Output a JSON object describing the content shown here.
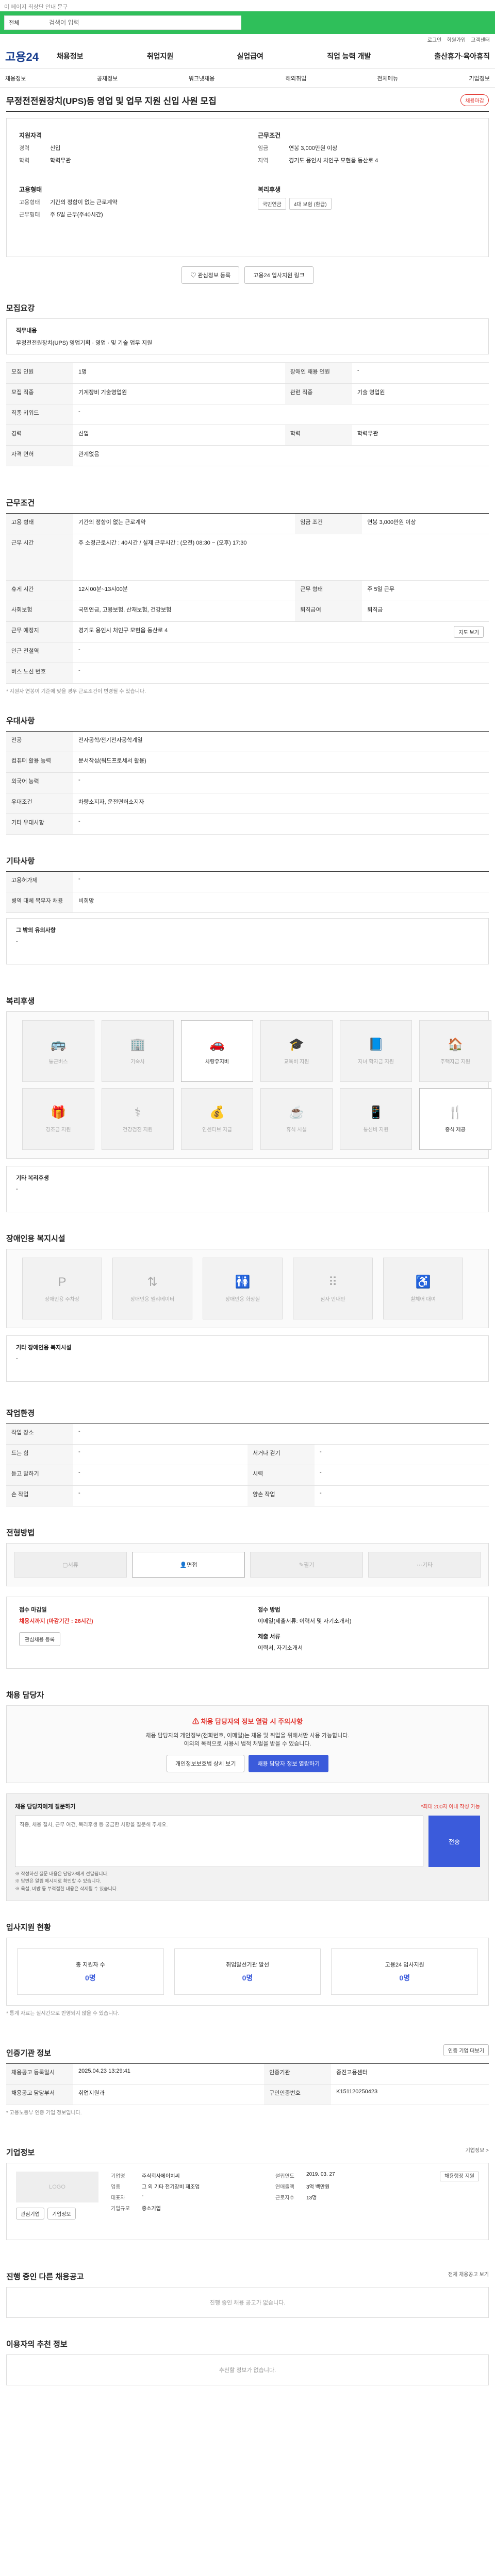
{
  "topnote": "이 페이지 최상단 안내 문구",
  "search": {
    "select": "전체",
    "placeholder": "검색어 입력"
  },
  "util": [
    "로그인",
    "회원가입",
    "고객센터"
  ],
  "logo": "고용24",
  "gnb": [
    "채용정보",
    "취업지원",
    "실업급여",
    "직업 능력 개발",
    "출산휴가·육아휴직"
  ],
  "subnav": [
    "채용정보",
    "공채정보",
    "워크넷채용",
    "해외취업",
    "전체메뉴",
    "기업정보"
  ],
  "title": "무정전전원장치(UPS)등 영업 및 업무 지원 신입 사원 모집",
  "title_badge": "채용마감",
  "summary": {
    "left_h": "지원자격",
    "left": [
      {
        "k": "경력",
        "v": "신입"
      },
      {
        "k": "학력",
        "v": "학력무관"
      }
    ],
    "cond_h": "고용형태",
    "cond": [
      {
        "k": "고용형태",
        "v": "기간의 정함이 없는 근로계약"
      },
      {
        "k": "근무형태",
        "v": "주 5일 근무(주40시간)"
      }
    ],
    "right_h": "근무조건",
    "right": [
      {
        "k": "임금",
        "v": "연봉 3,000만원 이상"
      },
      {
        "k": "지역",
        "v": "경기도 용인시 처인구 모현읍 동산로 4"
      }
    ],
    "wf_h": "복리후생",
    "chips": [
      "국민연금",
      "4대 보험 (환급)"
    ]
  },
  "actions": {
    "interest": "관심정보 등록",
    "share": "고용24 입사지원 링크"
  },
  "recruit": {
    "title": "모집요강",
    "duty_label": "직무내용",
    "duty": "무정전전원장치(UPS) 영업기획 · 영업 · 및 기술 업무 지원",
    "rows": [
      {
        "k": "모집 인원",
        "v": "1명",
        "k2": "장애인 채용 인원",
        "v2": "-"
      },
      {
        "k": "모집 직종",
        "v": "기계장비 기술영업원",
        "k2": "관련 직종",
        "v2": "기술 영업원"
      },
      {
        "k": "직종 키워드",
        "v": "-",
        "k2": "",
        "v2": ""
      },
      {
        "k": "경력",
        "v": "신입",
        "k2": "학력",
        "v2": "학력무관"
      },
      {
        "k": "자격 면허",
        "v": "관계없음",
        "k2": "",
        "v2": ""
      }
    ]
  },
  "work": {
    "title": "근무조건",
    "rows": [
      {
        "k": "고용 형태",
        "v": "기간의 정함이 없는 근로계약",
        "k2": "임금 조건",
        "v2": "연봉 3,000만원 이상"
      },
      {
        "k": "근무 시간",
        "v": "주 소정근로시간 : 40시간 / 실제 근무시간 : (오전) 08:30 ~ (오후) 17:30",
        "k2": "",
        "v2": ""
      },
      {
        "k": "휴게 시간",
        "v": "12시00분~13시00분",
        "k2": "근무 형태",
        "v2": "주 5일 근무"
      },
      {
        "k": "사회보험",
        "v": "국민연금, 고용보험, 산재보험, 건강보험",
        "k2": "퇴직급여",
        "v2": "퇴직금"
      },
      {
        "k": "근무 예정지",
        "v": "경기도 용인시 처인구 모현읍 동산로 4",
        "k2": "",
        "v2": ""
      },
      {
        "k": "인근 전철역",
        "v": "-",
        "k2": "",
        "v2": ""
      },
      {
        "k": "버스 노선 번호",
        "v": "-",
        "k2": "",
        "v2": ""
      }
    ],
    "map_btn": "지도 보기",
    "note": "* 지원자 연봉이 기준에 맞을 경우 근로조건이 변경될 수 있습니다."
  },
  "pref": {
    "title": "우대사항",
    "rows": [
      {
        "k": "전공",
        "v": "전자공학/전기전자공학계열"
      },
      {
        "k": "컴퓨터 활용 능력",
        "v": "문서작성(워드프로세서 활용)"
      },
      {
        "k": "외국어 능력",
        "v": "-"
      },
      {
        "k": "우대조건",
        "v": "차량소지자, 운전면허소지자"
      },
      {
        "k": "기타 우대사항",
        "v": "-"
      }
    ]
  },
  "etc": {
    "title": "기타사항",
    "rows": [
      {
        "k": "고용허가제",
        "v": "-"
      },
      {
        "k": "병역 대체 복무자 채용",
        "v": "비희망"
      }
    ],
    "box_label": "그 밖의 유의사항",
    "box_val": "-"
  },
  "welfare": {
    "title": "복리후생",
    "items": [
      "통근버스",
      "기숙사",
      "차량유지비",
      "교육비 지원",
      "자녀 학자금 지원",
      "주택자금 지원",
      "경조금 지원",
      "건강검진 지원",
      "인센티브 지급",
      "휴식 시설",
      "통신비 지원",
      "중식 제공"
    ],
    "on": [
      2,
      11
    ],
    "etc_label": "기타 복리후생",
    "etc_val": "-"
  },
  "disability": {
    "title": "장애인용 복지시설",
    "items": [
      "장애인용 주차장",
      "장애인용 엘리베이터",
      "장애인용 화장실",
      "점자 안내판",
      "휠체어 대여"
    ],
    "etc_label": "기타 장애인용 복지시설",
    "etc_val": "-"
  },
  "env": {
    "title": "작업환경",
    "rows": [
      {
        "k": "작업 장소",
        "v": "-",
        "k2": "",
        "v2": ""
      },
      {
        "k": "드는 힘",
        "v": "-",
        "k2": "서거나 걷기",
        "v2": "-"
      },
      {
        "k": "듣고 말하기",
        "v": "-",
        "k2": "시력",
        "v2": "-"
      },
      {
        "k": "손 작업",
        "v": "-",
        "k2": "양손 작업",
        "v2": "-"
      }
    ]
  },
  "process": {
    "title": "전형방법",
    "steps": [
      "서류",
      "면접",
      "필기",
      "기타"
    ],
    "on": 1
  },
  "apply": {
    "deadline_h": "접수 마감일",
    "deadline": "채용시까지 (마감기간 : 26시간)",
    "interest_btn": "관심채용 등록",
    "method_h": "접수 방법",
    "method": "이메일(제출서류: 이력서 및 자기소개서)",
    "docs_h": "제출 서류",
    "docs": "이력서, 자기소개서"
  },
  "manager": {
    "title": "채용 담당자",
    "warn_title": "채용 담당자의 정보 열람 시 주의사항",
    "warn_body": "채용 담당자의 개인정보(전화번호, 이메일)는 채용 및 취업을 위해서만 사용 가능합니다.",
    "warn_body2": "이외의 목적으로 사용시 법적 처벌을 받을 수 있습니다.",
    "btn_privacy": "개인정보보호법 상세 보기",
    "btn_view": "채용 담당자 정보 열람하기"
  },
  "question": {
    "title": "채용 담당자에게 질문하기",
    "count": "*최대 200자 이내 작성 가능",
    "placeholder": "직종, 채용 절차, 근무 여건, 복리후생 등 궁금한 사항을 질문해 주세요.",
    "btn": "전송",
    "foot1": "※ 작성하신 질문 내용은 담당자에게 전달됩니다.",
    "foot2": "※ 답변은 알림 메시지로 확인할 수 있습니다.",
    "foot3": "※ 욕설, 비방 등 부적절한 내용은 삭제될 수 있습니다."
  },
  "status": {
    "title": "입사지원 현황",
    "items": [
      {
        "k": "총 지원자 수",
        "v": "0명"
      },
      {
        "k": "취업알선기관 알선",
        "v": "0명"
      },
      {
        "k": "고용24 입사지원",
        "v": "0명"
      }
    ],
    "note": "* 통계 자료는 실시간으로 반영되지 않을 수 있습니다."
  },
  "cert": {
    "title": "인증기관 정보",
    "link": "인증 기업 더보기",
    "rows": [
      {
        "k": "채용공고 등록일시",
        "v": "2025.04.23 13:29:41",
        "k2": "인증기관",
        "v2": "중진고용센터"
      },
      {
        "k": "채용공고 담당부서",
        "v": "취업지원과",
        "k2": "구인인증번호",
        "v2": "K151120250423"
      }
    ],
    "note": "* 고용노동부 인증 기업 정보입니다."
  },
  "company": {
    "title": "기업정보",
    "more": "기업정보 >",
    "logo": "LOGO",
    "btn_follow": "관심기업",
    "btn_info": "기업정보",
    "info": [
      {
        "k": "기업명",
        "v": "주식회사에이치씨"
      },
      {
        "k": "업종",
        "v": "그 외 기타 전기장비 제조업"
      },
      {
        "k": "대표자",
        "v": "-"
      },
      {
        "k": "기업규모",
        "v": "중소기업"
      }
    ],
    "info2": [
      {
        "k": "설립연도",
        "v": "2019. 03. 27"
      },
      {
        "k": "연매출액",
        "v": "3억 백만원"
      },
      {
        "k": "근로자수",
        "v": "13명"
      }
    ],
    "badge": "채용행정 지원"
  },
  "ongoing": {
    "title": "진행 중인 다른 채용공고",
    "empty": "진행 중인 채용 공고가 없습니다.",
    "link": "전체 채용공고 보기"
  },
  "reco": {
    "title": "이용자의 추천 정보",
    "empty": "추천할 정보가 없습니다."
  }
}
